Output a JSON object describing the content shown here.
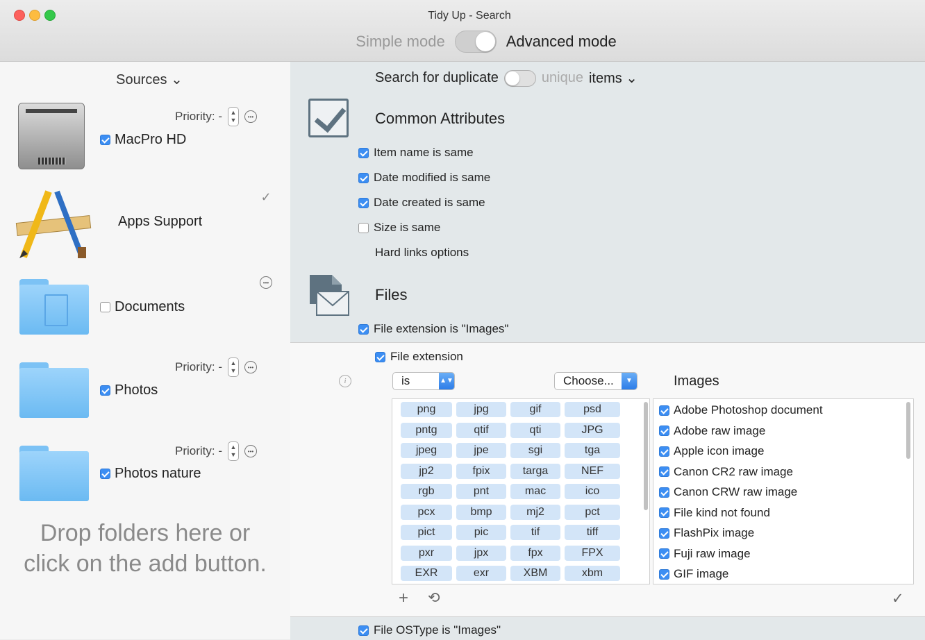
{
  "window": {
    "title": "Tidy Up - Search"
  },
  "mode": {
    "simple": "Simple mode",
    "advanced": "Advanced mode"
  },
  "sidebar": {
    "header": "Sources ⌄",
    "sources": [
      {
        "name": "MacPro HD",
        "checked": true,
        "priority_label": "Priority: -",
        "icon": "hard-drive-icon"
      },
      {
        "name": "Apps Support",
        "checked": null,
        "icon": "applications-icon"
      },
      {
        "name": "Documents",
        "checked": false,
        "icon": "folder-icon"
      },
      {
        "name": "Photos",
        "checked": true,
        "priority_label": "Priority: -",
        "icon": "folder-icon"
      },
      {
        "name": "Photos nature",
        "checked": true,
        "priority_label": "Priority: -",
        "icon": "folder-icon"
      }
    ],
    "drop_message_line1": "Drop folders here or",
    "drop_message_line2": "click on the add button."
  },
  "search": {
    "prefix": "Search for duplicate",
    "unique": "unique",
    "items": "items ⌄"
  },
  "common": {
    "title": "Common Attributes",
    "options": [
      {
        "label": "Item name is same",
        "checked": true
      },
      {
        "label": "Date modified is same",
        "checked": true
      },
      {
        "label": "Date created is same",
        "checked": true
      },
      {
        "label": "Size is same",
        "checked": false
      }
    ],
    "hard_links": "Hard links options"
  },
  "files": {
    "title": "Files",
    "ext_images": "File extension is \"Images\"",
    "file_extension": "File extension",
    "op_select": "is",
    "choose": "Choose...",
    "images_title": "Images",
    "ostype": "File OSType is \"Images\""
  },
  "extensions": [
    "png",
    "jpg",
    "gif",
    "psd",
    "pntg",
    "qtif",
    "qti",
    "JPG",
    "jpeg",
    "jpe",
    "sgi",
    "tga",
    "jp2",
    "fpix",
    "targa",
    "NEF",
    "rgb",
    "pnt",
    "mac",
    "ico",
    "pcx",
    "bmp",
    "mj2",
    "pct",
    "pict",
    "pic",
    "tif",
    "tiff",
    "pxr",
    "jpx",
    "fpx",
    "FPX",
    "EXR",
    "exr",
    "XBM",
    "xbm"
  ],
  "images": [
    "Adobe Photoshop document",
    "Adobe raw image",
    "Apple icon image",
    "Canon CR2 raw image",
    "Canon CRW raw image",
    "File kind not found",
    "FlashPix image",
    "Fuji raw image",
    "GIF image"
  ],
  "colors": {
    "accent": "#3c8ef3",
    "token_bg": "#d3e5f8",
    "panel_bg": "#e3e8ea"
  }
}
